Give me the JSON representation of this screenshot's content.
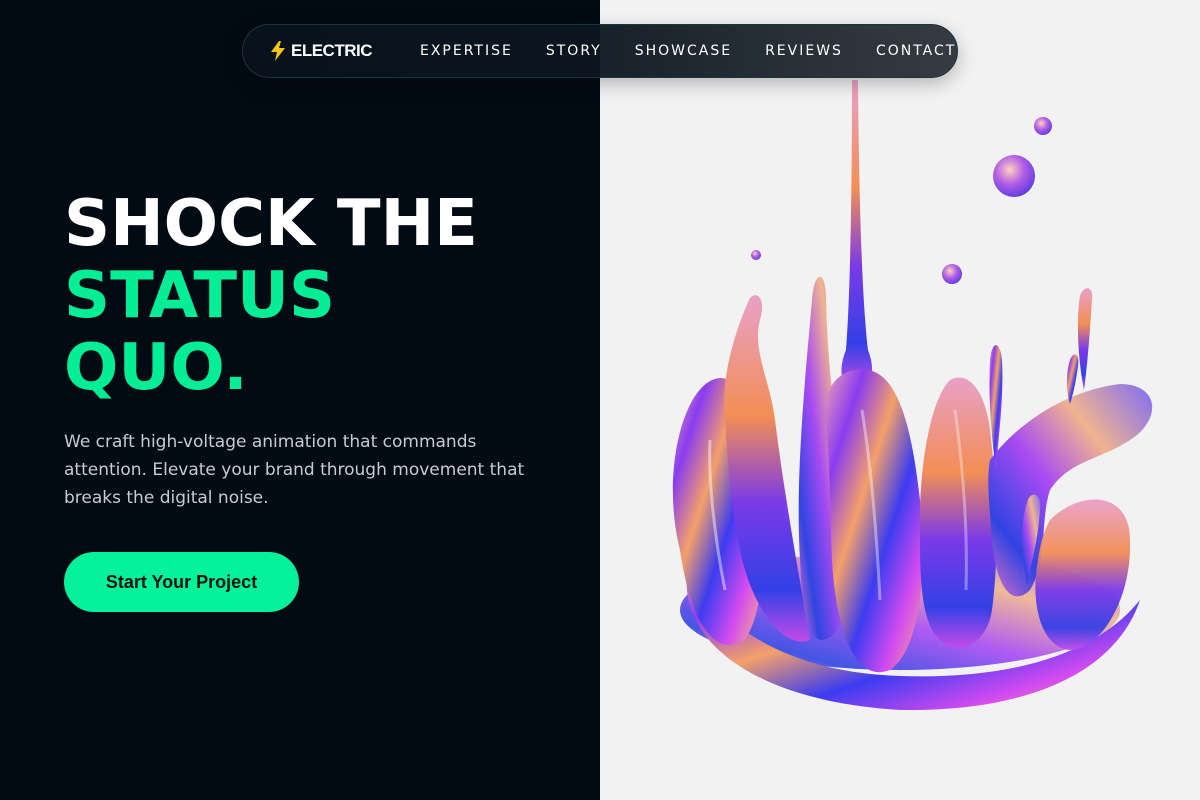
{
  "nav": {
    "brand": "ELECTRIC",
    "brand_icon": "lightning-bolt-icon",
    "links": [
      "EXPERTISE",
      "STORY",
      "SHOWCASE",
      "REVIEWS",
      "CONTACT"
    ]
  },
  "hero": {
    "title_line1": "SHOCK THE",
    "title_line2": "STATUS",
    "title_line3": "QUO.",
    "description": "We craft high-voltage animation that commands attention. Elevate your brand through movement that breaks the digital noise.",
    "cta_label": "Start Your Project"
  },
  "colors": {
    "background_dark": "#020a14",
    "background_light": "#f2f2f3",
    "accent": "#06ee95",
    "text_muted": "#c6ccd3"
  }
}
